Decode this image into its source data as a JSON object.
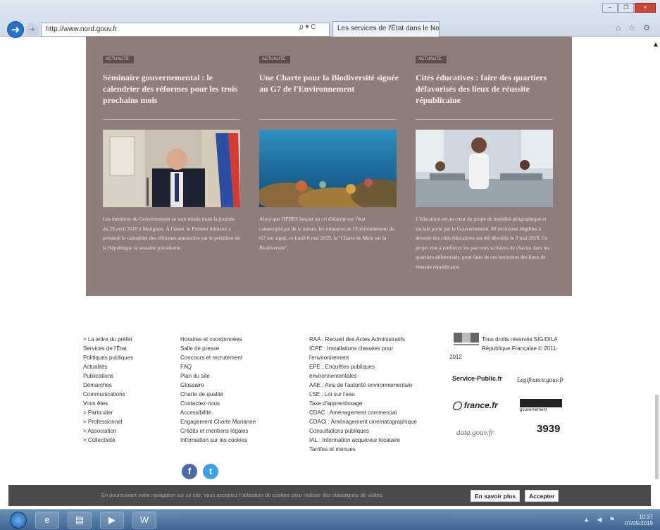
{
  "browser": {
    "back_icon": "back-arrow-icon",
    "forward_icon": "forward-arrow-icon",
    "url": "http://www.nord.gouv.fr",
    "search_refresh": "ρ ▾ C",
    "tab_title": "Les services de l'État dans le Nord",
    "tab_close": "×",
    "window_controls": [
      "–",
      "❐",
      "×"
    ],
    "toolbar_icons": "⌂ ☆ ⚙"
  },
  "news": {
    "cards": [
      {
        "tag": "ACTUALITÉ",
        "title": "Séminaire gouvernemental : le calendrier des réformes pour les trois prochains mois",
        "text": "Les membres du Gouvernement se sont réunis toute la journée du 29 avril 2019 à Matignon. À l'issue, le Premier ministre a présenté le calendrier des réformes annoncées par le président de la République la semaine précédente."
      },
      {
        "tag": "ACTUALITÉ",
        "title": "Une Charte pour la Biodiversité signée au G7 de l'Environnement",
        "text": "Alors que l'IPBES lançait un cri d'alarme sur l'état catastrophique de la nature, les ministres de l'Environnement du G7 ont signé, ce lundi 6 mai 2019, la \"Charte de Metz sur la Biodiversité\"."
      },
      {
        "tag": "ACTUALITÉ",
        "title": "Cités éducatives : faire des quartiers défavorisés des lieux de réussite républicaine",
        "text": "L'éducation est au cœur du projet de mobilité géographique et sociale porté par le Gouvernement. 80 territoires éligibles à devenir des cités éducatives ont été dévoilés le 3 mai 2019. Ce projet vise à renforcer les parcours scolaires de chacun dans les quartiers défavorisés, pour faire de ces territoires des lieux de réussite républicaine."
      }
    ]
  },
  "footer": {
    "col1": [
      "> La lettre du préfet",
      "Services de l'État",
      "Politiques publiques",
      "Actualités",
      "Publications",
      "Démarches",
      "Communications",
      "Vous êtes",
      "> Particulier",
      "> Professionnel",
      "> Association",
      "> Collectivité"
    ],
    "col2": [
      "Horaires et coordonnées",
      "Salle de presse",
      "Concours et recrutement",
      "FAQ",
      "Plan du site",
      "Glossaire",
      "Charte de qualité",
      "Contactez-nous",
      "Accessibilité",
      "Engagement Charte Marianne",
      "Crédits et mentions légales",
      "Information sur les cookies"
    ],
    "col3": [
      "RAA : Recueil des Actes Administratifs",
      "ICPE : Installations classées pour",
      "l'environnement",
      "EPE : Enquêtes publiques",
      "environnementales",
      "AAE : Avis de l'autorité environnementale",
      "LSE : Loi sur l'eau",
      "Taxe d'apprentissage",
      "CDAC : Aménagement commercial",
      "CDACi : Aménagement cinématographique",
      "Consultations publiques",
      "IAL : Information acquéreur locataire",
      "Tarrifes et menues"
    ],
    "rights": "Tous droits réservés SIG/DILA République Française © 2011-",
    "rights_year": "2012",
    "partners": {
      "service_public": "Service-Public.fr",
      "legifrance": "Legifrance.gouv.fr",
      "france_fr": "france.fr",
      "gouvernement": "gouvernement",
      "data_gouv": "data.gouv.fr",
      "phone": "3939"
    },
    "social": {
      "facebook": "f",
      "twitter": "t"
    }
  },
  "cookie": {
    "text": "En poursuivant votre navigation sur ce site, vous acceptez l'utilisation de cookies pour réaliser des statistiques de visites.",
    "more_label": "En savoir plus",
    "accept_label": "Accepter"
  },
  "taskbar": {
    "time": "10:37",
    "date": "07/05/2019",
    "tray_icons": "▲ ◀ ⚑",
    "items": [
      "ie-icon",
      "folder-icon",
      "media-icon",
      "word-icon"
    ]
  },
  "colors": {
    "news_bg": "#8d7e7c",
    "cookie_bg": "#4a4a4a",
    "facebook": "#4d6aa8",
    "twitter": "#3aa2e4"
  }
}
